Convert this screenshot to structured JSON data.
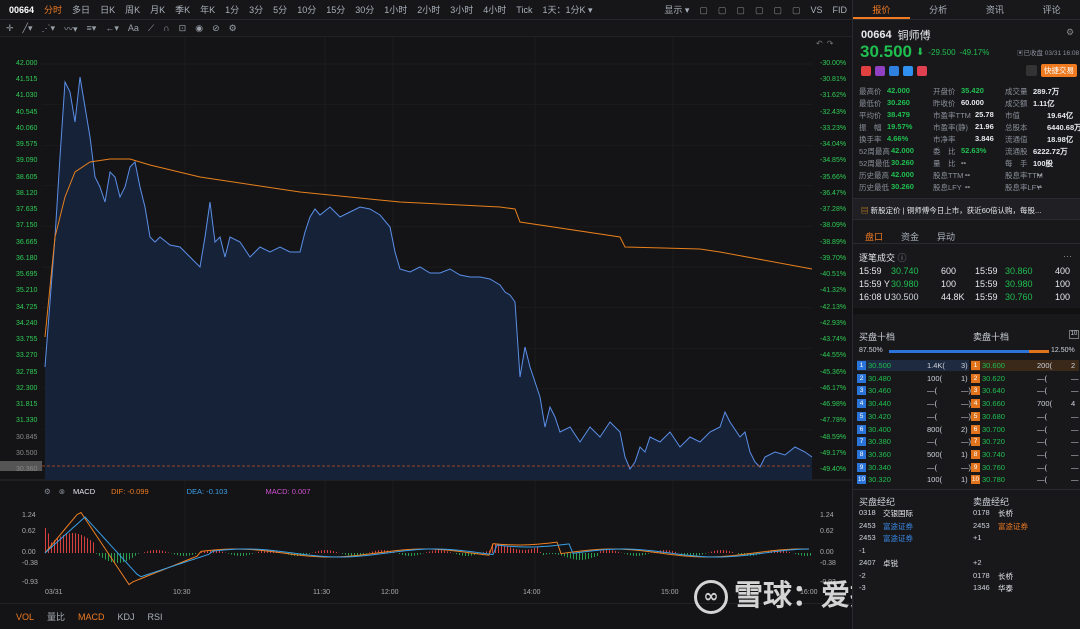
{
  "topbar": {
    "code": "00664",
    "periods": [
      "分时",
      "多日",
      "日K",
      "周K",
      "月K",
      "季K",
      "年K",
      "1分",
      "3分",
      "5分",
      "10分",
      "15分",
      "30分",
      "1小时",
      "2小时",
      "3小时",
      "4小时",
      "Tick",
      "1天：1分K ▾"
    ],
    "display": "显示 ▾",
    "vs": "VS",
    "fid": "FID"
  },
  "chart": {
    "price_ticks": [
      "42.000",
      "41.515",
      "41.030",
      "40.545",
      "40.060",
      "39.575",
      "39.090",
      "38.605",
      "38.120",
      "37.635",
      "37.150",
      "36.665",
      "36.180",
      "35.695",
      "35.210",
      "34.725",
      "34.240",
      "33.755",
      "33.270",
      "32.785",
      "32.300",
      "31.815",
      "31.330",
      "30.845",
      "30.500",
      "30.360"
    ],
    "pct_ticks": [
      "-30.00%",
      "-30.81%",
      "-31.62%",
      "-32.43%",
      "-33.23%",
      "-34.04%",
      "-34.85%",
      "-35.66%",
      "-36.47%",
      "-37.28%",
      "-38.09%",
      "-38.89%",
      "-39.70%",
      "-40.51%",
      "-41.32%",
      "-42.13%",
      "-42.93%",
      "-43.74%",
      "-44.55%",
      "-45.36%",
      "-46.17%",
      "-46.98%",
      "-47.78%",
      "-48.59%",
      "-49.17%",
      "-49.40%"
    ],
    "macd": {
      "label": "MACD",
      "dif": "DIF: -0.099",
      "dea": "DEA: -0.103",
      "val": "MACD: 0.007",
      "ticks": [
        "1.24",
        "0.62",
        "0.00",
        "-0.38",
        "-0.93"
      ]
    },
    "times": [
      "03/31",
      "10:30",
      "11:30",
      "12:00",
      "14:00",
      "15:00",
      "16:00"
    ]
  },
  "bottom": [
    "VOL",
    "量比",
    "MACD",
    "KDJ",
    "RSI"
  ],
  "watermark": "雪球：爱投资的小熊猫",
  "right": {
    "tabs": [
      "报价",
      "分析",
      "资讯",
      "评论"
    ],
    "code": "00664",
    "name": "铜师傅",
    "price": "30.500",
    "chg": "-29.500",
    "pct": "-49.17%",
    "closed": "已收盘 03/31 16:08",
    "fast": "快捷交易",
    "stats": [
      [
        "最高价",
        "42.000",
        "开盘价",
        "35.420",
        "成交量",
        "289.7万"
      ],
      [
        "最低价",
        "30.260",
        "昨收价",
        "60.000",
        "成交额",
        "1.11亿"
      ],
      [
        "平均价",
        "38.479",
        "市盈率TTM",
        "25.78",
        "市值",
        "19.64亿"
      ],
      [
        "振　幅",
        "19.57%",
        "市盈率(静)",
        "21.96",
        "总股本",
        "6440.68万"
      ],
      [
        "换手率",
        "4.66%",
        "市净率",
        "3.846",
        "流通值",
        "18.98亿"
      ],
      [
        "52周最高",
        "42.000",
        "委　比",
        "52.63%",
        "流通股",
        "6222.72万"
      ],
      [
        "52周最低",
        "30.260",
        "量　比",
        "--",
        "每　手",
        "100股"
      ],
      [
        "历史最高",
        "42.000",
        "股息TTM",
        "--",
        "股息率TTM",
        "--"
      ],
      [
        "历史最低",
        "30.260",
        "股息LFY",
        "--",
        "股息率LFY",
        "--"
      ]
    ],
    "news": "新股定价 | 铜师傅今日上市，获近60倍认购，每股...",
    "subtabs": [
      "盘口",
      "资金",
      "异动"
    ],
    "trades_title": "逐笔成交",
    "trades": [
      [
        "15:59",
        "30.740",
        "600",
        "15:59",
        "30.860",
        "400"
      ],
      [
        "15:59 Y",
        "30.980",
        "100",
        "15:59",
        "30.980",
        "100"
      ],
      [
        "16:08 U",
        "30.500",
        "44.8K",
        "15:59",
        "30.760",
        "100"
      ]
    ],
    "book": {
      "buy_title": "买盘十档",
      "sell_title": "卖盘十档",
      "buy_pct": "87.50%",
      "sell_pct": "12.50%",
      "bids": [
        [
          "1",
          "30.500",
          "1.4K(",
          "3)"
        ],
        [
          "2",
          "30.480",
          "100(",
          "1)"
        ],
        [
          "3",
          "30.460",
          "—(",
          "—)"
        ],
        [
          "4",
          "30.440",
          "—(",
          "—)"
        ],
        [
          "5",
          "30.420",
          "—(",
          "—)"
        ],
        [
          "6",
          "30.400",
          "800(",
          "2)"
        ],
        [
          "7",
          "30.380",
          "—(",
          "—)"
        ],
        [
          "8",
          "30.360",
          "500(",
          "1)"
        ],
        [
          "9",
          "30.340",
          "—(",
          "—)"
        ],
        [
          "10",
          "30.320",
          "100(",
          "1)"
        ]
      ],
      "asks": [
        [
          "1",
          "30.600",
          "200(",
          "2"
        ],
        [
          "2",
          "30.620",
          "—(",
          "—"
        ],
        [
          "3",
          "30.640",
          "—(",
          "—"
        ],
        [
          "4",
          "30.660",
          "700(",
          "4"
        ],
        [
          "5",
          "30.680",
          "—(",
          "—"
        ],
        [
          "6",
          "30.700",
          "—(",
          "—"
        ],
        [
          "7",
          "30.720",
          "—(",
          "—"
        ],
        [
          "8",
          "30.740",
          "—(",
          "—"
        ],
        [
          "9",
          "30.760",
          "—(",
          "—"
        ],
        [
          "10",
          "30.780",
          "—(",
          "—"
        ]
      ]
    },
    "brokers": {
      "buy_title": "买盘经纪",
      "sell_title": "卖盘经纪",
      "buy": [
        [
          "0318",
          "交银国际"
        ],
        [
          "2453",
          "富途证券"
        ],
        [
          "2453",
          "富途证券"
        ],
        [
          "-1",
          ""
        ],
        [
          "2407",
          "卓锐"
        ],
        [
          "-2",
          ""
        ],
        [
          "-3",
          ""
        ]
      ],
      "sell": [
        [
          "0178",
          "长桥"
        ],
        [
          "2453",
          "富途证券"
        ],
        [
          "+1",
          ""
        ],
        [
          "",
          ""
        ],
        [
          "+2",
          ""
        ],
        [
          "0178",
          "长桥"
        ],
        [
          "1346",
          "华泰"
        ]
      ]
    }
  }
}
